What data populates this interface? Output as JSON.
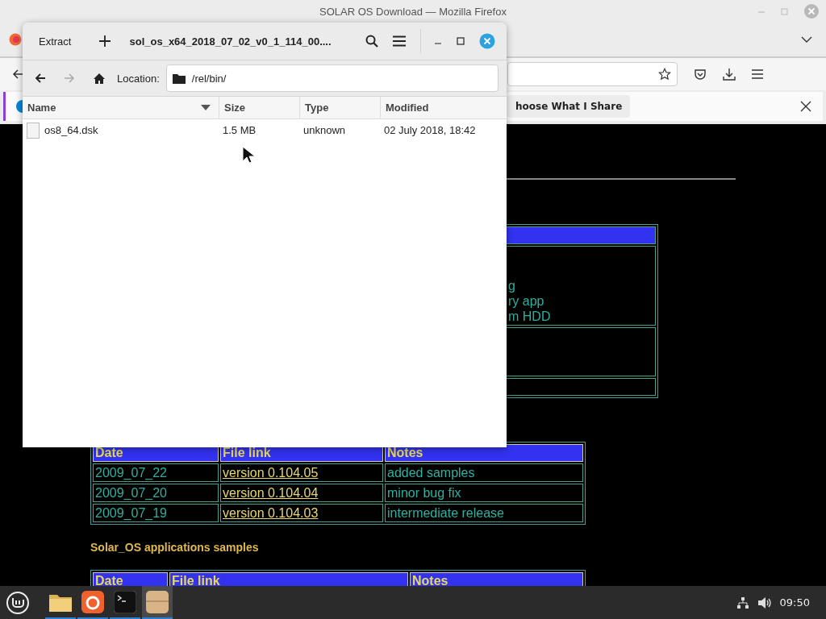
{
  "firefox": {
    "title": "SOLAR OS Download — Mozilla Firefox",
    "notification_button": "hoose What I Share"
  },
  "page": {
    "table_1_fragments": [
      "g",
      "ry app",
      "m HDD"
    ],
    "releases": {
      "columns": [
        "Date",
        "File link",
        "Notes"
      ],
      "rows": [
        {
          "date": "2009_07_22",
          "link": "version 0.104.05",
          "notes": "added samples"
        },
        {
          "date": "2009_07_20",
          "link": "version 0.104.04",
          "notes": "minor bug fix"
        },
        {
          "date": "2009_07_19",
          "link": "version 0.104.03",
          "notes": "intermediate release"
        }
      ]
    },
    "section_heading": "Solar_OS applications samples",
    "samples_table": {
      "columns": [
        "Date",
        "File link",
        "Notes"
      ]
    }
  },
  "archive": {
    "extract": "Extract",
    "title": "sol_os_x64_2018_07_02_v0_1_114_00....",
    "location_label": "Location:",
    "path": "/rel/bin/",
    "columns": [
      {
        "label": "Name",
        "sorted": true
      },
      {
        "label": "Size",
        "sorted": false
      },
      {
        "label": "Type",
        "sorted": false
      },
      {
        "label": "Modified",
        "sorted": false
      }
    ],
    "files": [
      {
        "name": "os8_64.dsk",
        "size": "1.5 MB",
        "type": "unknown",
        "modified": "02 July 2018, 18:42",
        "selected": false
      }
    ]
  },
  "taskbar": {
    "apps": [
      {
        "kind": "files",
        "active": false
      },
      {
        "kind": "firefox",
        "active": false
      },
      {
        "kind": "terminal",
        "active": false
      },
      {
        "kind": "archive",
        "active": true
      }
    ],
    "clock": "09:50"
  }
}
